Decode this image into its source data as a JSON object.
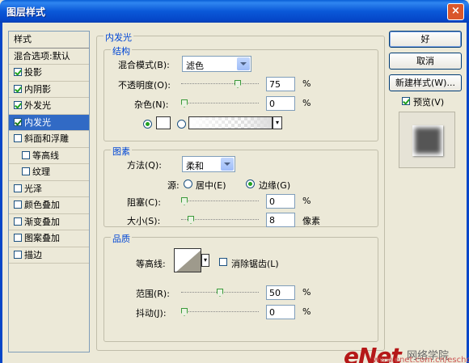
{
  "window": {
    "title": "图层样式",
    "close": "×"
  },
  "styles_list": {
    "header": "样式",
    "blend_default": "混合选项:默认",
    "items": [
      {
        "label": "投影",
        "checked": true,
        "indent": false,
        "selected": false
      },
      {
        "label": "内阴影",
        "checked": true,
        "indent": false,
        "selected": false
      },
      {
        "label": "外发光",
        "checked": true,
        "indent": false,
        "selected": false
      },
      {
        "label": "内发光",
        "checked": true,
        "indent": false,
        "selected": true
      },
      {
        "label": "斜面和浮雕",
        "checked": false,
        "indent": false,
        "selected": false
      },
      {
        "label": "等高线",
        "checked": false,
        "indent": true,
        "selected": false
      },
      {
        "label": "纹理",
        "checked": false,
        "indent": true,
        "selected": false
      },
      {
        "label": "光泽",
        "checked": false,
        "indent": false,
        "selected": false
      },
      {
        "label": "颜色叠加",
        "checked": false,
        "indent": false,
        "selected": false
      },
      {
        "label": "渐变叠加",
        "checked": false,
        "indent": false,
        "selected": false
      },
      {
        "label": "图案叠加",
        "checked": false,
        "indent": false,
        "selected": false
      },
      {
        "label": "描边",
        "checked": false,
        "indent": false,
        "selected": false
      }
    ]
  },
  "inner_glow": {
    "section_title": "内发光",
    "structure": {
      "title": "结构",
      "blend_mode_label": "混合模式(B):",
      "blend_mode_value": "滤色",
      "opacity_label": "不透明度(O):",
      "opacity_value": "75",
      "opacity_percent": 75,
      "noise_label": "杂色(N):",
      "noise_value": "0",
      "noise_percent": 0,
      "percent": "%"
    },
    "elements": {
      "title": "图素",
      "method_label": "方法(Q):",
      "method_value": "柔和",
      "source_label": "源:",
      "center_label": "居中(E)",
      "edge_label": "边缘(G)",
      "choke_label": "阻塞(C):",
      "choke_value": "0",
      "choke_percent": 0,
      "size_label": "大小(S):",
      "size_value": "8",
      "size_unit": "像素",
      "percent": "%"
    },
    "quality": {
      "title": "品质",
      "contour_label": "等高线:",
      "antialias_label": "消除锯齿(L)",
      "range_label": "范围(R):",
      "range_value": "50",
      "range_percent": 50,
      "jitter_label": "抖动(J):",
      "jitter_value": "0",
      "jitter_percent": 0,
      "percent": "%"
    }
  },
  "buttons": {
    "ok": "好",
    "cancel": "取消",
    "new_style": "新建样式(W)...",
    "preview_label": "预览(V)"
  },
  "watermark": {
    "brand": "eNet",
    "cn": "网络学院",
    "xx": "XX",
    "url": "www.enet.com.cn/eschool"
  }
}
